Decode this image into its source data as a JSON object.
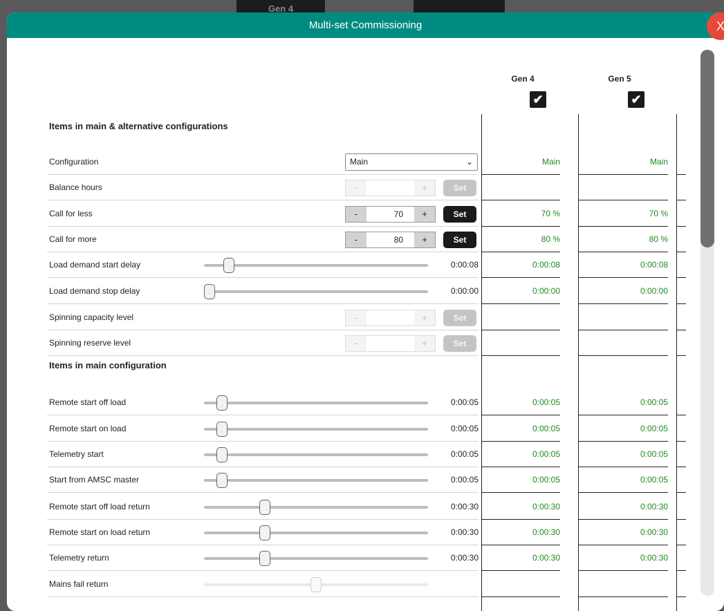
{
  "background": {
    "tab_left": "Gen 4"
  },
  "modal": {
    "title": "Multi-set Commissioning",
    "close_label": "X"
  },
  "generators": [
    {
      "name": "Gen 4",
      "checked": true
    },
    {
      "name": "Gen 5",
      "checked": true
    }
  ],
  "check_glyph": "✔",
  "sections": [
    {
      "heading": "Items in main & alternative configurations",
      "rows": [
        {
          "label": "Configuration",
          "type": "select",
          "value": "Main",
          "gen4": "Main",
          "gen5": "Main"
        },
        {
          "label": "Balance hours",
          "type": "stepper",
          "disabled": true,
          "value": "",
          "minus": "-",
          "plus": "+",
          "set": "Set",
          "gen4": "",
          "gen5": ""
        },
        {
          "label": "Call for less",
          "type": "stepper",
          "disabled": false,
          "value": "70",
          "minus": "-",
          "plus": "+",
          "set": "Set",
          "gen4": "70 %",
          "gen5": "70 %"
        },
        {
          "label": "Call for more",
          "type": "stepper",
          "disabled": false,
          "value": "80",
          "minus": "-",
          "plus": "+",
          "set": "Set",
          "gen4": "80 %",
          "gen5": "80 %"
        },
        {
          "label": "Load demand start delay",
          "type": "slider",
          "level": 0.09,
          "value": "0:00:08",
          "gen4": "0:00:08",
          "gen5": "0:00:08"
        },
        {
          "label": "Load demand stop delay",
          "type": "slider",
          "level": 0.0,
          "value": "0:00:00",
          "gen4": "0:00:00",
          "gen5": "0:00:00"
        },
        {
          "label": "Spinning capacity level",
          "type": "stepper",
          "disabled": true,
          "value": "",
          "minus": "-",
          "plus": "+",
          "set": "Set",
          "gen4": "",
          "gen5": ""
        },
        {
          "label": "Spinning reserve level",
          "type": "stepper",
          "disabled": true,
          "value": "",
          "minus": "-",
          "plus": "+",
          "set": "Set",
          "gen4": "",
          "gen5": ""
        }
      ]
    },
    {
      "heading": "Items in main configuration",
      "rows": [
        {
          "label": "Remote start off load",
          "type": "slider",
          "level": 0.06,
          "value": "0:00:05",
          "gen4": "0:00:05",
          "gen5": "0:00:05"
        },
        {
          "label": "Remote start on load",
          "type": "slider",
          "level": 0.06,
          "value": "0:00:05",
          "gen4": "0:00:05",
          "gen5": "0:00:05"
        },
        {
          "label": "Telemetry start",
          "type": "slider",
          "level": 0.06,
          "value": "0:00:05",
          "gen4": "0:00:05",
          "gen5": "0:00:05"
        },
        {
          "label": "Start from AMSC master",
          "type": "slider",
          "level": 0.06,
          "value": "0:00:05",
          "gen4": "0:00:05",
          "gen5": "0:00:05"
        },
        {
          "label": "Remote start off load return",
          "type": "slider",
          "level": 0.26,
          "value": "0:00:30",
          "gen4": "0:00:30",
          "gen5": "0:00:30"
        },
        {
          "label": "Remote start on load return",
          "type": "slider",
          "level": 0.26,
          "value": "0:00:30",
          "gen4": "0:00:30",
          "gen5": "0:00:30"
        },
        {
          "label": "Telemetry return",
          "type": "slider",
          "level": 0.26,
          "value": "0:00:30",
          "gen4": "0:00:30",
          "gen5": "0:00:30"
        },
        {
          "label": "Mains fail return",
          "type": "slider",
          "level": 0.5,
          "disabled": true,
          "value": "",
          "gen4": "",
          "gen5": ""
        }
      ]
    }
  ],
  "scrollbar": {
    "position": 0.0
  }
}
